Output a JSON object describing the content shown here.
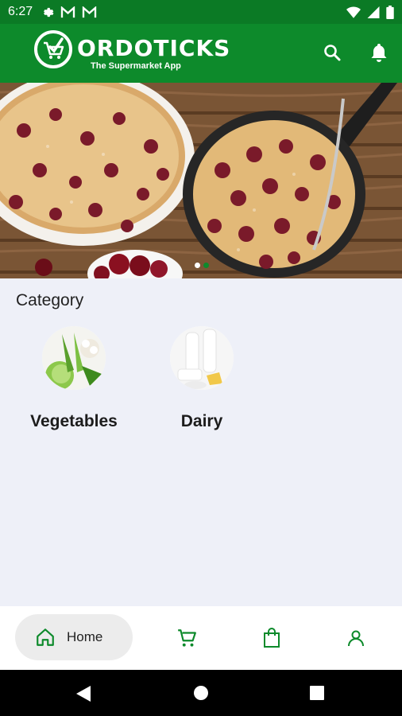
{
  "status_bar": {
    "time": "6:27"
  },
  "app_bar": {
    "brand": "ORDOTICKS",
    "tagline": "The Supermarket App"
  },
  "banner": {
    "slides": 2,
    "active_slide": 1
  },
  "category": {
    "title": "Category",
    "items": [
      {
        "label": "Vegetables"
      },
      {
        "label": "Dairy"
      }
    ]
  },
  "bottom_nav": {
    "items": [
      {
        "label": "Home",
        "icon": "home-icon",
        "active": true
      },
      {
        "label": "",
        "icon": "cart-icon",
        "active": false
      },
      {
        "label": "",
        "icon": "bag-icon",
        "active": false
      },
      {
        "label": "",
        "icon": "profile-icon",
        "active": false
      }
    ]
  },
  "colors": {
    "primary": "#0d8a2b",
    "status_bar": "#0b7a25",
    "background": "#eef0f8"
  }
}
